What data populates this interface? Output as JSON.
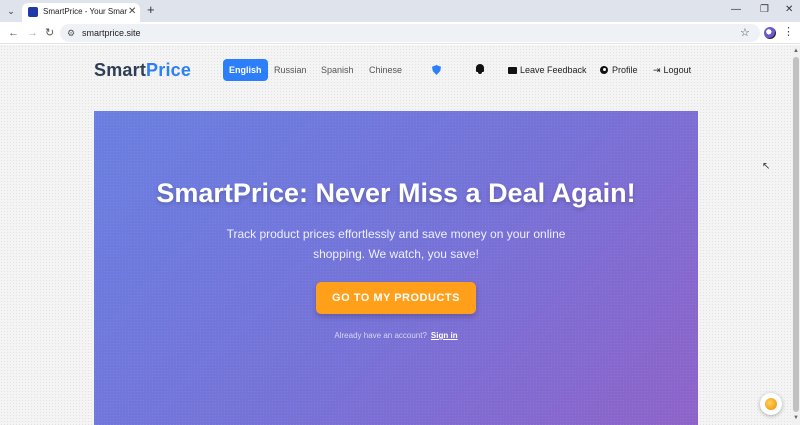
{
  "browser": {
    "tab_title": "SmartPrice - Your Smart Shoppi",
    "new_tab_symbol": "+",
    "tab_close_symbol": "✕",
    "url": "smartprice.site",
    "window_controls": [
      "—",
      "❐",
      "✕"
    ]
  },
  "site": {
    "logo_part1": "Smart",
    "logo_part2": "Price",
    "brand_color": "#2d7ff9",
    "languages": [
      {
        "label": "English",
        "active": true
      },
      {
        "label": "Russian",
        "active": false
      },
      {
        "label": "Spanish",
        "active": false
      },
      {
        "label": "Chinese",
        "active": false
      }
    ],
    "nav": {
      "feedback": "Leave Feedback",
      "profile": "Profile",
      "logout": "Logout"
    },
    "icons": [
      "shield-icon",
      "bell-icon",
      "speech-bubble-icon",
      "user-circle-icon",
      "logout-icon"
    ]
  },
  "hero": {
    "title": "SmartPrice: Never Miss a Deal Again!",
    "subtitle": "Track product prices effortlessly and save money on your online shopping. We watch, you save!",
    "cta_label": "GO TO MY PRODUCTS",
    "cta_color": "#ff9f1a",
    "signin_prompt": "Already have an account?",
    "signin_link": "Sign in",
    "gradient_from": "#6a7fe1",
    "gradient_to": "#8e63c9"
  }
}
